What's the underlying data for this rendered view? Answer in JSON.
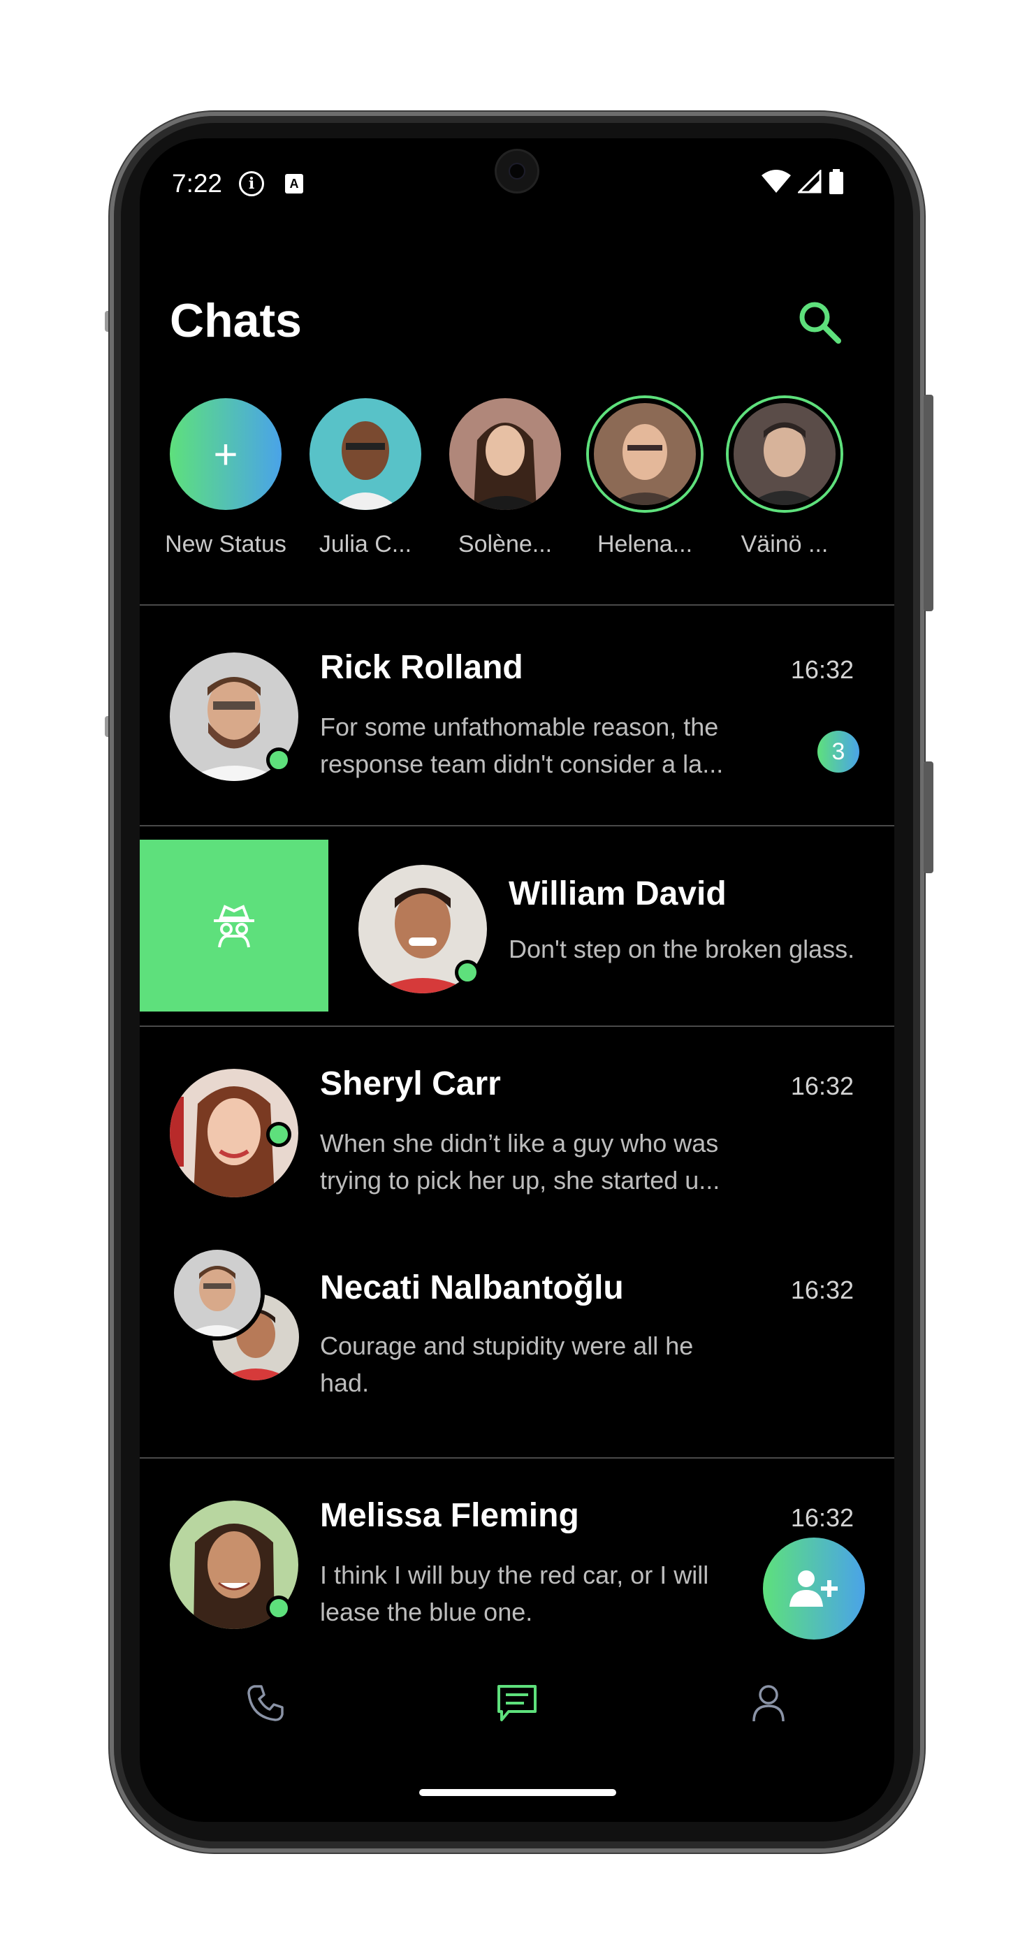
{
  "status_bar": {
    "time": "7:22",
    "info_glyph": "i",
    "a_glyph": "A"
  },
  "header": {
    "title": "Chats"
  },
  "stories": [
    {
      "label": "New Status",
      "icon": "plus-icon"
    },
    {
      "label": "Julia C..."
    },
    {
      "label": "Solène..."
    },
    {
      "label": "Helena..."
    },
    {
      "label": "Väinö ..."
    }
  ],
  "chats": [
    {
      "name": "Rick Rolland",
      "time": "16:32",
      "message_line1": "For some unfathomable reason, the",
      "message_line2": "response team didn't consider a la...",
      "unread": "3"
    },
    {
      "name": "William David",
      "message": "Don't step on the broken glass."
    },
    {
      "name": "Sheryl Carr",
      "time": "16:32",
      "message_line1": "When she didn’t like a guy who was",
      "message_line2": "trying to pick her up, she started u..."
    },
    {
      "name": "Necati Nalbantoğlu",
      "time": "16:32",
      "message_line1": "Courage and stupidity were all he",
      "message_line2": "had."
    },
    {
      "name": "Melissa Fleming",
      "time": "16:32",
      "message_line1": "I think I will buy the red car, or I will",
      "message_line2": "lease the blue one."
    }
  ],
  "colors": {
    "accent_green": "#5ee07c",
    "accent_blue": "#4aa3e8",
    "background": "#000000"
  },
  "bottom_nav": [
    {
      "icon": "phone-icon",
      "active": false
    },
    {
      "icon": "chat-icon",
      "active": true
    },
    {
      "icon": "person-icon",
      "active": false
    }
  ]
}
